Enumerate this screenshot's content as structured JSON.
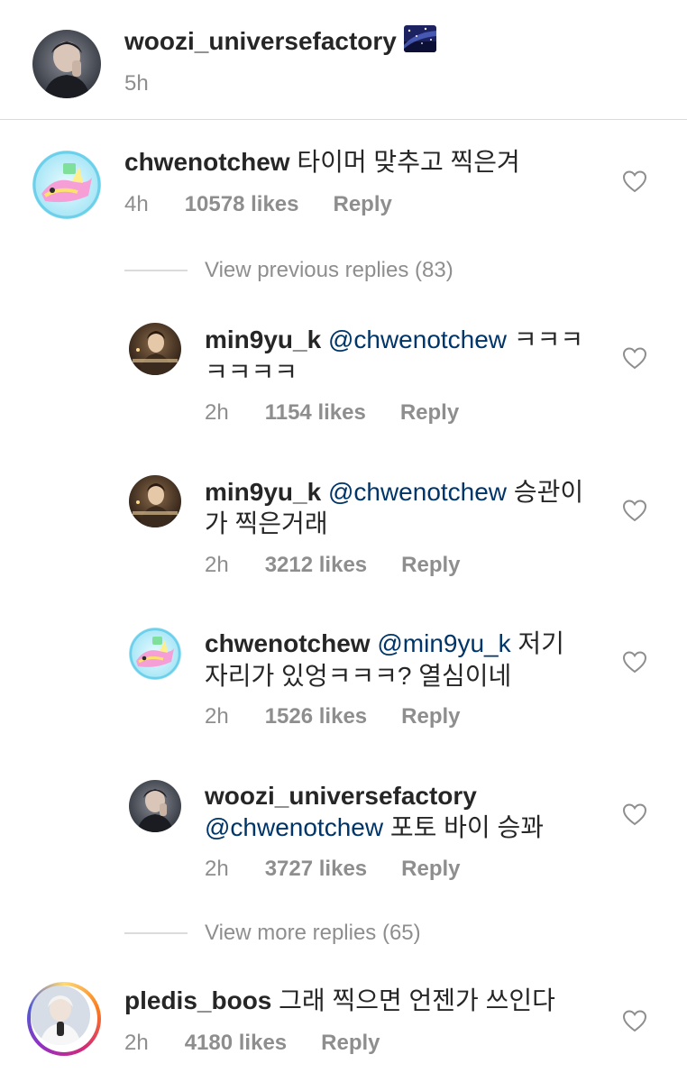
{
  "caption": {
    "username": "woozi_universefactory",
    "time": "5h",
    "emoji_icon": "milky-way-emoji"
  },
  "comment_main": {
    "username": "chwenotchew",
    "text": "타이머 맞추고 찍은겨",
    "time": "4h",
    "likes": "10578 likes",
    "reply": "Reply"
  },
  "view_previous": "View previous replies (83)",
  "replies": [
    {
      "username": "min9yu_k",
      "mention": "@chwenotchew",
      "text_line1": "ㅋㅋㅋ",
      "text_line2": "ㅋㅋㅋㅋ",
      "time": "2h",
      "likes": "1154 likes",
      "reply": "Reply"
    },
    {
      "username": "min9yu_k",
      "mention": "@chwenotchew",
      "text_line1": "승관이",
      "text_line2": "가 찍은거래",
      "time": "2h",
      "likes": "3212 likes",
      "reply": "Reply"
    },
    {
      "username": "chwenotchew",
      "mention": "@min9yu_k",
      "text_line1": "저기",
      "text_line2": "자리가 있엉ㅋㅋㅋ? 열심이네",
      "time": "2h",
      "likes": "1526 likes",
      "reply": "Reply"
    },
    {
      "username": "woozi_universefactory",
      "mention": "@chwenotchew",
      "text_line2": "포토 바이 승꽈",
      "time": "2h",
      "likes": "3727 likes",
      "reply": "Reply"
    }
  ],
  "view_more": "View more replies (65)",
  "comment_last": {
    "username": "pledis_boos",
    "text": "그래 찍으면 언젠가 쓰인다",
    "time": "2h",
    "likes": "4180 likes",
    "reply": "Reply"
  },
  "icons": {
    "like": "heart-outline-icon"
  },
  "colors": {
    "mention": "#003569",
    "meta": "#8e8e8e",
    "divider": "#dbdbdb"
  }
}
